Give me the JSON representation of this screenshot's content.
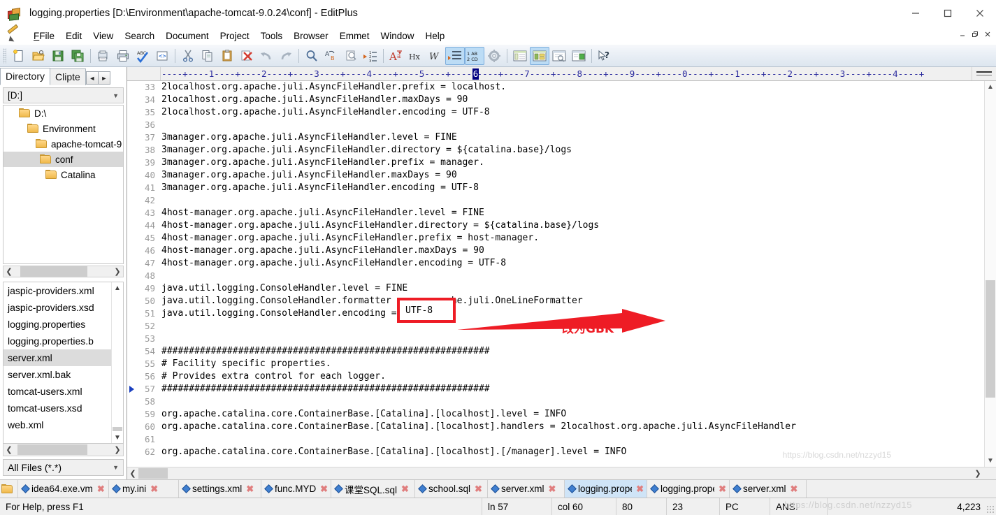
{
  "window": {
    "title": "logging.properties [D:\\Environment\\apache-tomcat-9.0.24\\conf] - EditPlus",
    "app_icon": "editplus-icon",
    "minimize": "—",
    "maximize": "☐",
    "close": "✕",
    "mdi_minimize": "–",
    "mdi_restore": "❐",
    "mdi_close": "✕"
  },
  "menu": {
    "items": [
      {
        "label": "File"
      },
      {
        "label": "Edit"
      },
      {
        "label": "View"
      },
      {
        "label": "Search"
      },
      {
        "label": "Document"
      },
      {
        "label": "Project"
      },
      {
        "label": "Tools"
      },
      {
        "label": "Browser"
      },
      {
        "label": "Emmet"
      },
      {
        "label": "Window"
      },
      {
        "label": "Help"
      }
    ]
  },
  "toolbar": {
    "buttons": [
      {
        "name": "new-file-icon",
        "active": false
      },
      {
        "name": "open-file-icon",
        "active": false
      },
      {
        "name": "save-icon",
        "active": false
      },
      {
        "name": "save-all-icon",
        "active": false
      },
      {
        "name": "sep",
        "active": false
      },
      {
        "name": "print-preview-icon",
        "active": false
      },
      {
        "name": "print-icon",
        "active": false
      },
      {
        "name": "spell-check-icon",
        "active": false
      },
      {
        "name": "view-source-icon",
        "active": false
      },
      {
        "name": "sep",
        "active": false
      },
      {
        "name": "cut-icon",
        "active": false
      },
      {
        "name": "copy-icon",
        "active": false
      },
      {
        "name": "paste-icon",
        "active": false
      },
      {
        "name": "delete-icon",
        "active": false
      },
      {
        "name": "undo-icon",
        "active": false
      },
      {
        "name": "redo-icon",
        "active": false
      },
      {
        "name": "sep",
        "active": false
      },
      {
        "name": "find-icon",
        "active": false
      },
      {
        "name": "replace-icon",
        "active": false
      },
      {
        "name": "find-in-files-icon",
        "active": false
      },
      {
        "name": "goto-line-icon",
        "active": false
      },
      {
        "name": "sep",
        "active": false
      },
      {
        "name": "font-icon",
        "active": false
      },
      {
        "name": "hex-view-icon",
        "active": false
      },
      {
        "name": "word-wrap-icon",
        "active": false
      },
      {
        "name": "indent-icon",
        "active": true
      },
      {
        "name": "line-numbers-icon",
        "active": true
      },
      {
        "name": "preferences-icon",
        "active": false
      },
      {
        "name": "sep",
        "active": false
      },
      {
        "name": "document-window-icon",
        "active": false
      },
      {
        "name": "split-window-icon",
        "active": true
      },
      {
        "name": "preview-window-icon",
        "active": false
      },
      {
        "name": "browser-window-icon",
        "active": false
      },
      {
        "name": "sep",
        "active": false
      },
      {
        "name": "context-help-icon",
        "active": false
      }
    ]
  },
  "sidebar": {
    "tabs": [
      {
        "label": "Directory",
        "selected": true
      },
      {
        "label": "Clipte",
        "selected": false
      }
    ],
    "nav_prev": "◄",
    "nav_next": "►",
    "drive_value": "[D:]",
    "tree": [
      {
        "label": "D:\\",
        "depth": 0,
        "selected": false
      },
      {
        "label": "Environment",
        "depth": 1,
        "selected": false
      },
      {
        "label": "apache-tomcat-9",
        "depth": 2,
        "selected": false
      },
      {
        "label": "conf",
        "depth": 3,
        "selected": true
      },
      {
        "label": "Catalina",
        "depth": 4,
        "selected": false
      }
    ],
    "files": [
      {
        "label": "jaspic-providers.xml",
        "selected": false
      },
      {
        "label": "jaspic-providers.xsd",
        "selected": false
      },
      {
        "label": "logging.properties",
        "selected": false
      },
      {
        "label": "logging.properties.b",
        "selected": false
      },
      {
        "label": "server.xml",
        "selected": true
      },
      {
        "label": "server.xml.bak",
        "selected": false
      },
      {
        "label": "tomcat-users.xml",
        "selected": false
      },
      {
        "label": "tomcat-users.xsd",
        "selected": false
      },
      {
        "label": "web.xml",
        "selected": false
      }
    ],
    "filter_value": "All Files (*.*)"
  },
  "editor": {
    "ruler": "----+----1----+----2----+----3----+----4----+----5----+----6----+----7----+----8----+----9----+----0----+----1----+----2----+----3----+----4----+",
    "ruler_caret_col": 60,
    "bookmark_line": 57,
    "lines": [
      {
        "n": "33",
        "text": "2localhost.org.apache.juli.AsyncFileHandler.prefix = localhost."
      },
      {
        "n": "34",
        "text": "2localhost.org.apache.juli.AsyncFileHandler.maxDays = 90"
      },
      {
        "n": "35",
        "text": "2localhost.org.apache.juli.AsyncFileHandler.encoding = UTF-8"
      },
      {
        "n": "36",
        "text": ""
      },
      {
        "n": "37",
        "text": "3manager.org.apache.juli.AsyncFileHandler.level = FINE"
      },
      {
        "n": "38",
        "text": "3manager.org.apache.juli.AsyncFileHandler.directory = ${catalina.base}/logs"
      },
      {
        "n": "39",
        "text": "3manager.org.apache.juli.AsyncFileHandler.prefix = manager."
      },
      {
        "n": "40",
        "text": "3manager.org.apache.juli.AsyncFileHandler.maxDays = 90"
      },
      {
        "n": "41",
        "text": "3manager.org.apache.juli.AsyncFileHandler.encoding = UTF-8"
      },
      {
        "n": "42",
        "text": ""
      },
      {
        "n": "43",
        "text": "4host-manager.org.apache.juli.AsyncFileHandler.level = FINE"
      },
      {
        "n": "44",
        "text": "4host-manager.org.apache.juli.AsyncFileHandler.directory = ${catalina.base}/logs"
      },
      {
        "n": "45",
        "text": "4host-manager.org.apache.juli.AsyncFileHandler.prefix = host-manager."
      },
      {
        "n": "46",
        "text": "4host-manager.org.apache.juli.AsyncFileHandler.maxDays = 90"
      },
      {
        "n": "47",
        "text": "4host-manager.org.apache.juli.AsyncFileHandler.encoding = UTF-8"
      },
      {
        "n": "48",
        "text": ""
      },
      {
        "n": "49",
        "text": "java.util.logging.ConsoleHandler.level = FINE"
      },
      {
        "n": "50",
        "text": "java.util.logging.ConsoleHandler.formatter = org.apache.juli.OneLineFormatter"
      },
      {
        "n": "51",
        "text": "java.util.logging.ConsoleHandler.encoding = UTF-8"
      },
      {
        "n": "52",
        "text": ""
      },
      {
        "n": "53",
        "text": ""
      },
      {
        "n": "54",
        "text": "############################################################"
      },
      {
        "n": "55",
        "text": "# Facility specific properties."
      },
      {
        "n": "56",
        "text": "# Provides extra control for each logger."
      },
      {
        "n": "57",
        "text": "############################################################"
      },
      {
        "n": "58",
        "text": ""
      },
      {
        "n": "59",
        "text": "org.apache.catalina.core.ContainerBase.[Catalina].[localhost].level = INFO"
      },
      {
        "n": "60",
        "text": "org.apache.catalina.core.ContainerBase.[Catalina].[localhost].handlers = 2localhost.org.apache.juli.AsyncFileHandler"
      },
      {
        "n": "61",
        "text": ""
      },
      {
        "n": "62",
        "text": "org.apache.catalina.core.ContainerBase.[Catalina].[localhost].[/manager].level = INFO"
      }
    ]
  },
  "annotation": {
    "highlight_value": "UTF-8",
    "label": "改为GBK",
    "box_color": "#ee1c25",
    "arrow_color": "#ee1c25"
  },
  "doc_tabs": [
    {
      "label": "idea64.exe.vm",
      "selected": false
    },
    {
      "label": "my.ini",
      "selected": false
    },
    {
      "label": "settings.xml",
      "selected": false
    },
    {
      "label": "func.MYD",
      "selected": false
    },
    {
      "label": "课堂SQL.sql",
      "selected": false
    },
    {
      "label": "school.sql",
      "selected": false
    },
    {
      "label": "server.xml",
      "selected": false
    },
    {
      "label": "logging.prope",
      "selected": true
    },
    {
      "label": "logging.prope",
      "selected": false
    },
    {
      "label": "server.xml",
      "selected": false
    }
  ],
  "statusbar": {
    "help": "For Help, press F1",
    "line": "ln 57",
    "col": "col 60",
    "value1": "80",
    "value2": "23",
    "platform": "PC",
    "encoding": "ANSI",
    "filesize": "4,223",
    "watermark": "https://blog.csdn.net/nzzyd15"
  }
}
